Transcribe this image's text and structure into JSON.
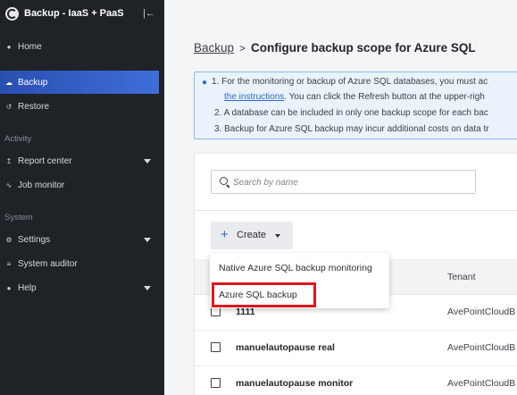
{
  "app": {
    "title": "Backup - IaaS + PaaS",
    "logo_icon": "avepoint-logo-icon",
    "collapse_icon": "collapse-sidebar-icon"
  },
  "sidebar": {
    "items": [
      {
        "label": "Home",
        "icon": "home-icon"
      },
      {
        "label": "Backup",
        "icon": "cloud-icon",
        "active": true
      },
      {
        "label": "Restore",
        "icon": "restore-icon"
      },
      {
        "label": "Report center",
        "icon": "report-icon",
        "has_submenu": true
      },
      {
        "label": "Job monitor",
        "icon": "pulse-icon"
      },
      {
        "label": "Settings",
        "icon": "gear-icon",
        "has_submenu": true
      },
      {
        "label": "System auditor",
        "icon": "list-icon"
      },
      {
        "label": "Help",
        "icon": "help-icon",
        "has_submenu": true
      }
    ],
    "sections": {
      "activity": "Activity",
      "system": "System"
    }
  },
  "breadcrumb": {
    "parent": "Backup",
    "separator": ">",
    "current": "Configure backup scope for Azure SQL"
  },
  "info": {
    "line1": "1. For the monitoring or backup of Azure SQL databases, you must ac",
    "line1b_link": "the instructions",
    "line1b_rest": ". You can click the Refresh button at the upper-righ",
    "line2": "2. A database can be included in only one backup scope for each bac",
    "line3": "3. Backup for Azure SQL backup may incur additional costs on data tr"
  },
  "search": {
    "placeholder": "Search by name",
    "value": ""
  },
  "toolbar": {
    "create_label": "Create"
  },
  "dropdown": {
    "items": [
      {
        "label": "Native Azure SQL backup monitoring"
      },
      {
        "label": "Azure SQL backup",
        "highlighted": true
      }
    ]
  },
  "table": {
    "columns": {
      "tenant": "Tenant"
    },
    "rows": [
      {
        "name": "1111",
        "tenant": "AvePointCloudB"
      },
      {
        "name": "manuelautopause real",
        "tenant": "AvePointCloudB"
      },
      {
        "name": "manuelautopause monitor",
        "tenant": "AvePointCloudB"
      }
    ]
  },
  "colors": {
    "sidebar_bg": "#1f2227",
    "active_item": "#3f6ed8",
    "accent": "#2d69c8",
    "highlight": "#e0161c"
  }
}
